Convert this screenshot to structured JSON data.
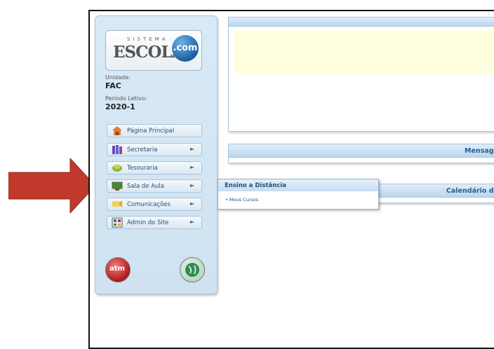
{
  "logo": {
    "top_text": "SISTEMA",
    "main_text": "ESCOLA1",
    "badge": ".com"
  },
  "info": {
    "unidade_label": "Unidade:",
    "unidade_value": "FAC",
    "periodo_label": "Período Letivo:",
    "periodo_value": "2020-1"
  },
  "sidebar": {
    "items": [
      {
        "label": "Página Principal",
        "icon": "home-icon",
        "arrow": ""
      },
      {
        "label": "Secretaria",
        "icon": "books-icon",
        "arrow": "►"
      },
      {
        "label": "Tesouraria",
        "icon": "money-icon",
        "arrow": "►"
      },
      {
        "label": "Sala de Aula",
        "icon": "classroom-icon",
        "arrow": "►"
      },
      {
        "label": "Comunicações",
        "icon": "communication-icon",
        "arrow": "►"
      },
      {
        "label": "Admin do Site",
        "icon": "admin-icon",
        "arrow": "►"
      }
    ]
  },
  "submenu": {
    "title": "Ensino a Distância",
    "items": [
      "Meus Cursos"
    ]
  },
  "panels": {
    "messages_title": "Mensage",
    "calendar_title": "Calendário de"
  },
  "buttons": {
    "atm": "atm"
  },
  "colors": {
    "arrow": "#c0392b",
    "accent": "#2a5f8e",
    "notice": "#ffffe0"
  }
}
